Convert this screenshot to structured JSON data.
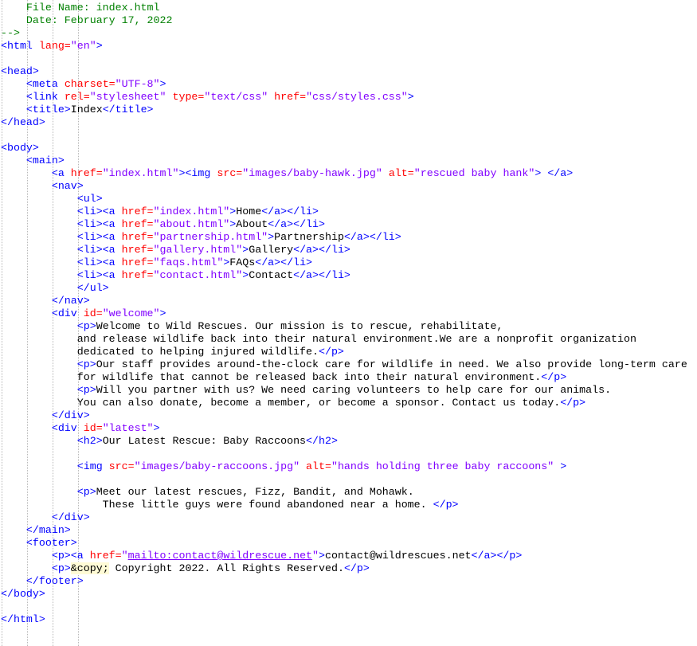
{
  "editor": {
    "file": "index.html",
    "lines": [
      [
        [
          "c",
          "    File Name: index.html"
        ]
      ],
      [
        [
          "c",
          "    Date: February 17, 2022"
        ]
      ],
      [
        [
          "c",
          "-->"
        ]
      ],
      [
        [
          "t",
          "<html "
        ],
        [
          "a",
          "lang="
        ],
        [
          "v",
          "\"en\""
        ],
        [
          "t",
          ">"
        ]
      ],
      [],
      [
        [
          "t",
          "<head>"
        ]
      ],
      [
        [
          "p",
          "    "
        ],
        [
          "t",
          "<meta "
        ],
        [
          "a",
          "charset="
        ],
        [
          "v",
          "\"UTF-8\""
        ],
        [
          "t",
          ">"
        ]
      ],
      [
        [
          "p",
          "    "
        ],
        [
          "t",
          "<link "
        ],
        [
          "a",
          "rel="
        ],
        [
          "v",
          "\"stylesheet\""
        ],
        [
          "p",
          " "
        ],
        [
          "a",
          "type="
        ],
        [
          "v",
          "\"text/css\""
        ],
        [
          "p",
          " "
        ],
        [
          "a",
          "href="
        ],
        [
          "v",
          "\"css/styles.css\""
        ],
        [
          "t",
          ">"
        ]
      ],
      [
        [
          "p",
          "    "
        ],
        [
          "t",
          "<title>"
        ],
        [
          "p",
          "Index"
        ],
        [
          "t",
          "</title>"
        ]
      ],
      [
        [
          "t",
          "</head>"
        ]
      ],
      [],
      [
        [
          "t",
          "<body>"
        ]
      ],
      [
        [
          "p",
          "    "
        ],
        [
          "t",
          "<main>"
        ]
      ],
      [
        [
          "p",
          "        "
        ],
        [
          "t",
          "<a "
        ],
        [
          "a",
          "href="
        ],
        [
          "v",
          "\"index.html\""
        ],
        [
          "t",
          "><img "
        ],
        [
          "a",
          "src="
        ],
        [
          "v",
          "\"images/baby-hawk.jpg\""
        ],
        [
          "p",
          " "
        ],
        [
          "a",
          "alt="
        ],
        [
          "v",
          "\"rescued baby hank\""
        ],
        [
          "t",
          "> </a>"
        ]
      ],
      [
        [
          "p",
          "        "
        ],
        [
          "t",
          "<nav>"
        ]
      ],
      [
        [
          "p",
          "            "
        ],
        [
          "t",
          "<ul>"
        ]
      ],
      [
        [
          "p",
          "            "
        ],
        [
          "t",
          "<li><a "
        ],
        [
          "a",
          "href="
        ],
        [
          "v",
          "\"index.html\""
        ],
        [
          "t",
          ">"
        ],
        [
          "p",
          "Home"
        ],
        [
          "t",
          "</a></li>"
        ]
      ],
      [
        [
          "p",
          "            "
        ],
        [
          "t",
          "<li><a "
        ],
        [
          "a",
          "href="
        ],
        [
          "v",
          "\"about.html\""
        ],
        [
          "t",
          ">"
        ],
        [
          "p",
          "About"
        ],
        [
          "t",
          "</a></li>"
        ]
      ],
      [
        [
          "p",
          "            "
        ],
        [
          "t",
          "<li><a "
        ],
        [
          "a",
          "href="
        ],
        [
          "v",
          "\"partnership.html\""
        ],
        [
          "t",
          ">"
        ],
        [
          "p",
          "Partnership"
        ],
        [
          "t",
          "</a></li>"
        ]
      ],
      [
        [
          "p",
          "            "
        ],
        [
          "t",
          "<li><a "
        ],
        [
          "a",
          "href="
        ],
        [
          "v",
          "\"gallery.html\""
        ],
        [
          "t",
          ">"
        ],
        [
          "p",
          "Gallery"
        ],
        [
          "t",
          "</a></li>"
        ]
      ],
      [
        [
          "p",
          "            "
        ],
        [
          "t",
          "<li><a "
        ],
        [
          "a",
          "href="
        ],
        [
          "v",
          "\"faqs.html\""
        ],
        [
          "t",
          ">"
        ],
        [
          "p",
          "FAQs"
        ],
        [
          "t",
          "</a></li>"
        ]
      ],
      [
        [
          "p",
          "            "
        ],
        [
          "t",
          "<li><a "
        ],
        [
          "a",
          "href="
        ],
        [
          "v",
          "\"contact.html\""
        ],
        [
          "t",
          ">"
        ],
        [
          "p",
          "Contact"
        ],
        [
          "t",
          "</a></li>"
        ]
      ],
      [
        [
          "p",
          "            "
        ],
        [
          "t",
          "</ul>"
        ]
      ],
      [
        [
          "p",
          "        "
        ],
        [
          "t",
          "</nav>"
        ]
      ],
      [
        [
          "p",
          "        "
        ],
        [
          "t",
          "<div "
        ],
        [
          "a",
          "id="
        ],
        [
          "v",
          "\"welcome\""
        ],
        [
          "t",
          ">"
        ]
      ],
      [
        [
          "p",
          "            "
        ],
        [
          "t",
          "<p>"
        ],
        [
          "p",
          "Welcome to Wild Rescues. Our mission is to rescue, rehabilitate,"
        ]
      ],
      [
        [
          "p",
          "            and release wildlife back into their natural environment.We are a nonprofit organization"
        ]
      ],
      [
        [
          "p",
          "            dedicated to helping injured wildlife."
        ],
        [
          "t",
          "</p>"
        ]
      ],
      [
        [
          "p",
          "            "
        ],
        [
          "t",
          "<p>"
        ],
        [
          "p",
          "Our staff provides around-the-clock care for wildlife in need. We also provide long-term care"
        ]
      ],
      [
        [
          "p",
          "            for wildlife that cannot be released back into their natural environment."
        ],
        [
          "t",
          "</p>"
        ]
      ],
      [
        [
          "p",
          "            "
        ],
        [
          "t",
          "<p>"
        ],
        [
          "p",
          "Will you partner with us? We need caring volunteers to help care for our animals."
        ]
      ],
      [
        [
          "p",
          "            You can also donate, become a member, or become a sponsor. Contact us today."
        ],
        [
          "t",
          "</p>"
        ]
      ],
      [
        [
          "p",
          "        "
        ],
        [
          "t",
          "</div>"
        ]
      ],
      [
        [
          "p",
          "        "
        ],
        [
          "t",
          "<div "
        ],
        [
          "a",
          "id="
        ],
        [
          "v",
          "\"latest\""
        ],
        [
          "t",
          ">"
        ]
      ],
      [
        [
          "p",
          "            "
        ],
        [
          "t",
          "<h2>"
        ],
        [
          "p",
          "Our Latest Rescue: Baby Raccoons"
        ],
        [
          "t",
          "</h2>"
        ]
      ],
      [],
      [
        [
          "p",
          "            "
        ],
        [
          "t",
          "<img "
        ],
        [
          "a",
          "src="
        ],
        [
          "v",
          "\"images/baby-raccoons.jpg\""
        ],
        [
          "p",
          " "
        ],
        [
          "a",
          "alt="
        ],
        [
          "v",
          "\"hands holding three baby raccoons\""
        ],
        [
          "p",
          " "
        ],
        [
          "t",
          ">"
        ]
      ],
      [],
      [
        [
          "p",
          "            "
        ],
        [
          "t",
          "<p>"
        ],
        [
          "p",
          "Meet our latest rescues, Fizz, Bandit, and Mohawk."
        ]
      ],
      [
        [
          "p",
          "                These little guys were found abandoned near a home. "
        ],
        [
          "t",
          "</p>"
        ]
      ],
      [
        [
          "p",
          "        "
        ],
        [
          "t",
          "</div>"
        ]
      ],
      [
        [
          "p",
          "    "
        ],
        [
          "t",
          "</main>"
        ]
      ],
      [
        [
          "p",
          "    "
        ],
        [
          "t",
          "<footer>"
        ]
      ],
      [
        [
          "p",
          "        "
        ],
        [
          "t",
          "<p><a "
        ],
        [
          "a",
          "href="
        ],
        [
          "v",
          "\""
        ],
        [
          "l",
          "mailto:contact@wildrescue.net"
        ],
        [
          "v",
          "\""
        ],
        [
          "t",
          ">"
        ],
        [
          "p",
          "contact@wildrescues.net"
        ],
        [
          "t",
          "</a></p>"
        ]
      ],
      [
        [
          "p",
          "        "
        ],
        [
          "t",
          "<p>"
        ],
        [
          "e",
          "&copy;"
        ],
        [
          "p",
          " Copyright 2022. All Rights Reserved."
        ],
        [
          "t",
          "</p>"
        ]
      ],
      [
        [
          "p",
          "    "
        ],
        [
          "t",
          "</footer>"
        ]
      ],
      [
        [
          "t",
          "</body>"
        ]
      ],
      [],
      [
        [
          "t",
          "</html>"
        ]
      ]
    ]
  }
}
